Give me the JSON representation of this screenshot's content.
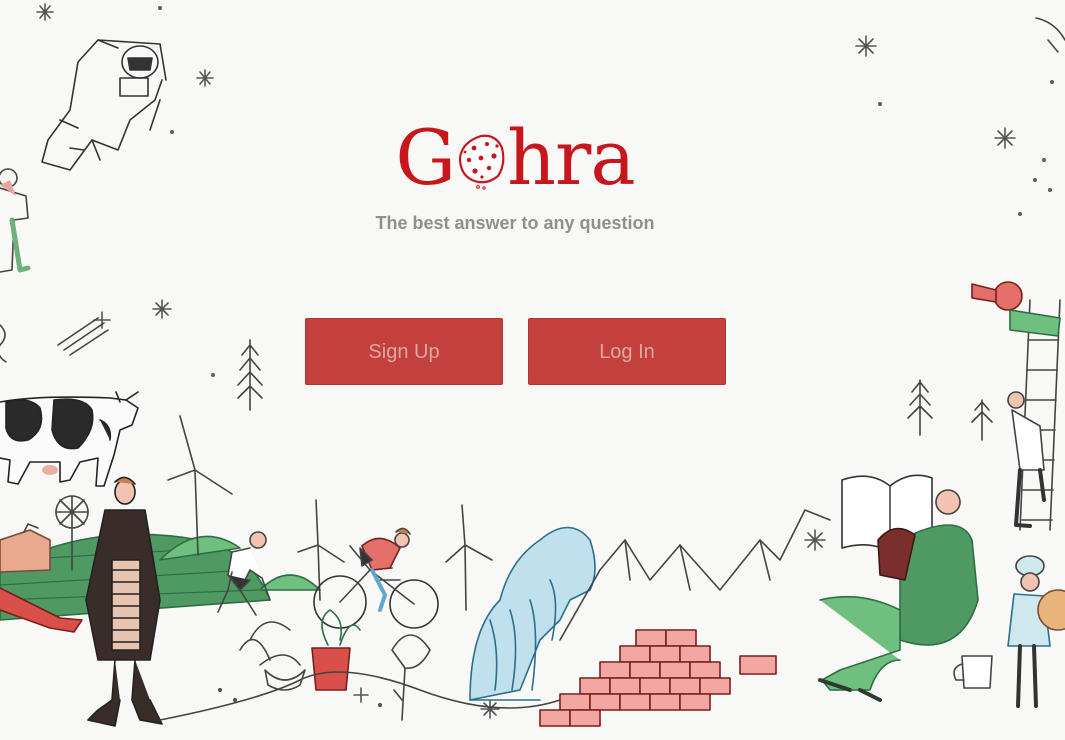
{
  "logo": {
    "prefix": "G",
    "suffix": "hra",
    "color": "#c8161d"
  },
  "tagline": "The best answer to any question",
  "buttons": {
    "signup_label": "Sign Up",
    "login_label": "Log In",
    "color": "#c3403d"
  },
  "illustration": {
    "icons": [
      "astronaut-icon",
      "cow-icon",
      "wind-turbine-icon",
      "cyclist-icon",
      "wave-icon",
      "brick-wall-icon",
      "reading-person-icon",
      "ladder-person-icon",
      "mountain-icon",
      "plant-icon"
    ]
  }
}
